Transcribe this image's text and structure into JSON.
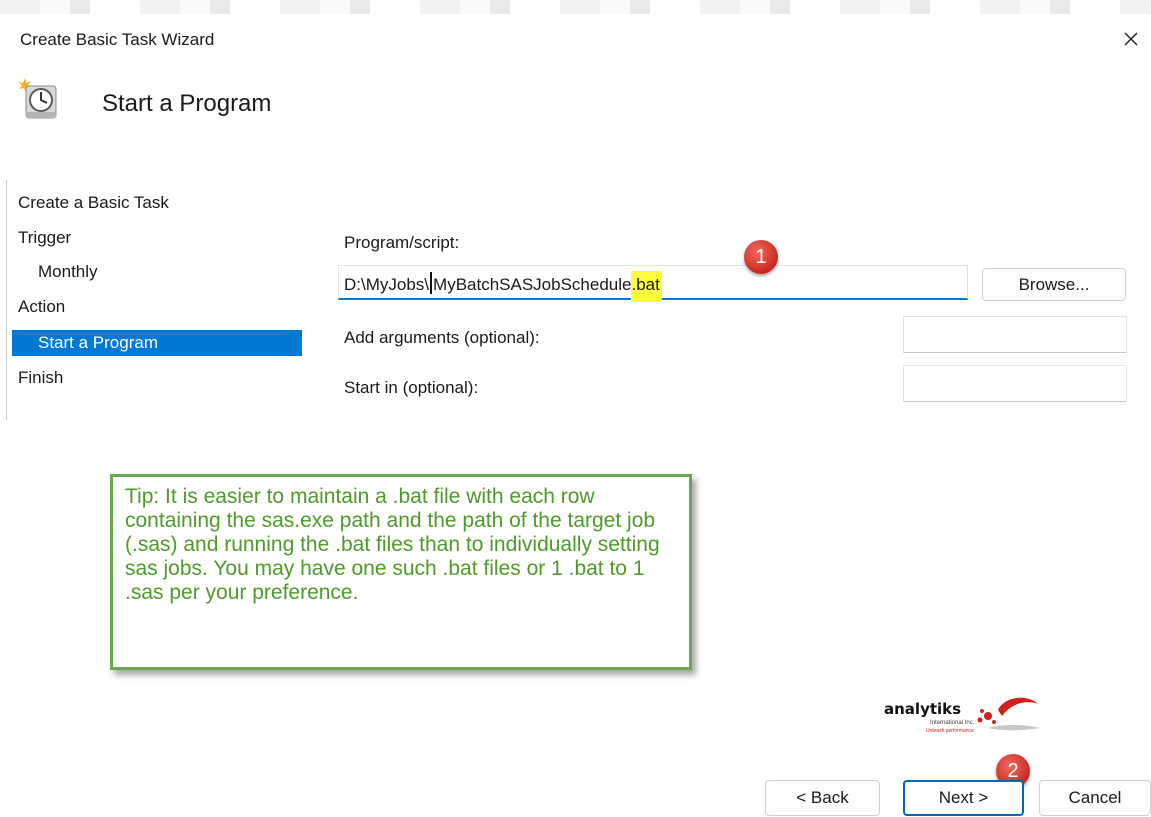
{
  "window": {
    "title": "Create Basic Task Wizard"
  },
  "header": {
    "title": "Start a Program",
    "icon": "scheduled-task-clock-icon"
  },
  "nav": {
    "items": [
      {
        "label": "Create a Basic Task",
        "selected": false
      },
      {
        "label": "Trigger",
        "selected": false
      },
      {
        "label": "Monthly",
        "selected": false
      },
      {
        "label": "Action",
        "selected": false
      },
      {
        "label": "Start a Program",
        "selected": true
      },
      {
        "label": "Finish",
        "selected": false
      }
    ]
  },
  "form": {
    "program_label": "Program/script:",
    "program_value_prefix": "D:\\MyJobs\\",
    "program_value_name": "MyBatchSASJobSchedule",
    "program_value_ext": ".bat",
    "browse_label": "Browse...",
    "arguments_label": "Add arguments (optional):",
    "arguments_value": "",
    "startin_label": "Start in (optional):",
    "startin_value": ""
  },
  "annotations": {
    "badge1": "1",
    "badge2": "2",
    "tip": "Tip: It is easier to maintain a .bat file with each row containing the sas.exe path and the path of the target job (.sas) and running the .bat files than to individually setting sas jobs.  You may have one such .bat files or 1 .bat to 1 .sas per your preference."
  },
  "logo": {
    "name": "analytiks",
    "sub1": "International Inc.",
    "sub2": "Unleash performance"
  },
  "footer": {
    "back_label": "< Back",
    "next_label": "Next >",
    "cancel_label": "Cancel"
  },
  "colors": {
    "accent": "#0078d4",
    "highlight": "#fdfd3d",
    "tip_green": "#4e9a2a",
    "badge_red": "#d0342c"
  }
}
